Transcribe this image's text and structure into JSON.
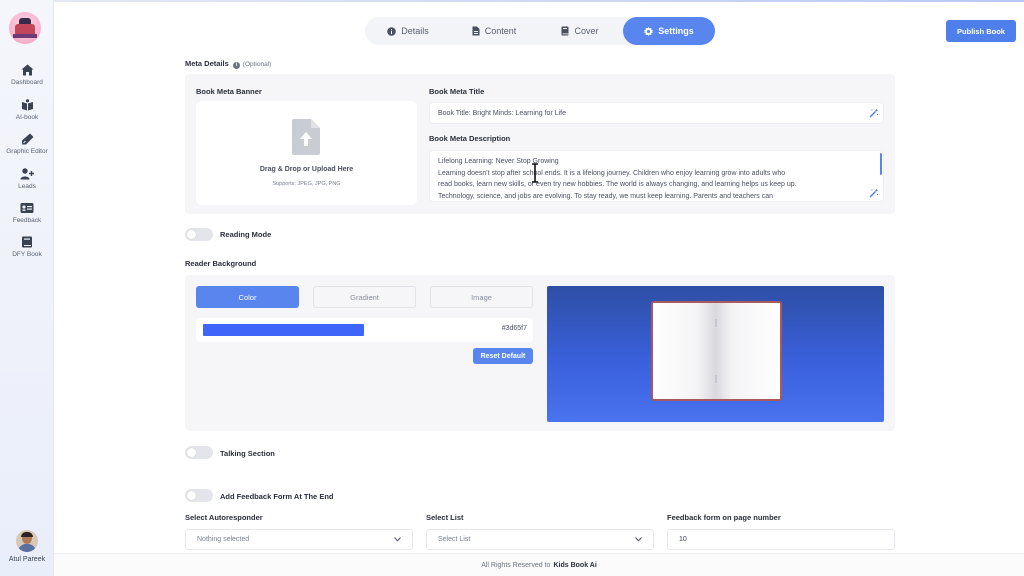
{
  "sidebar": {
    "items": [
      {
        "label": "Dashboard",
        "icon": "home-icon"
      },
      {
        "label": "AI-book",
        "icon": "ai-book-icon"
      },
      {
        "label": "Graphic Editor",
        "icon": "pen-icon"
      },
      {
        "label": "Leads",
        "icon": "add-user-icon"
      },
      {
        "label": "Feedback",
        "icon": "feedback-icon"
      },
      {
        "label": "DFY Book",
        "icon": "book-icon"
      }
    ],
    "user_name": "Atul Pareek"
  },
  "tabs": [
    {
      "label": "Details",
      "icon": "info-icon",
      "active": false
    },
    {
      "label": "Content",
      "icon": "document-icon",
      "active": false
    },
    {
      "label": "Cover",
      "icon": "book-icon",
      "active": false
    },
    {
      "label": "Settings",
      "icon": "gear-icon",
      "active": true
    }
  ],
  "publish_label": "Publish Book",
  "meta": {
    "title": "Meta Details",
    "optional": "(Optional)",
    "banner_label": "Book Meta Banner",
    "upload_title": "Drag & Drop or Upload Here",
    "upload_sub": "Supports: JPEG, JPG, PNG",
    "meta_title_label": "Book Meta Title",
    "meta_title_value": "Book Title: Bright Minds: Learning for Life",
    "meta_desc_label": "Book Meta Description",
    "meta_desc_line1": "Lifelong Learning: Never Stop Growing",
    "meta_desc_line2": "Learning doesn't stop after school ends. It is a lifelong journey. Children who enjoy learning grow into adults who",
    "meta_desc_line3": "read books, learn new skills, or even try new hobbies. The world is always changing, and learning helps us keep up.",
    "meta_desc_line4": "Technology, science, and jobs are evolving. To stay ready, we must keep learning. Parents and teachers can"
  },
  "reading_mode_label": "Reading Mode",
  "reader_bg": {
    "title": "Reader Background",
    "tabs": [
      "Color",
      "Gradient",
      "Image"
    ],
    "color_hex": "#3d65f7",
    "reset_label": "Reset Default"
  },
  "talking_section_label": "Talking Section",
  "feedback_form_label": "Add Feedback Form At The End",
  "selects": {
    "autoresponder_label": "Select Autoresponder",
    "autoresponder_value": "Nothing selected",
    "list_label": "Select List",
    "list_value": "Select List",
    "page_label": "Feedback form on page number",
    "page_value": "10"
  },
  "footer": {
    "text": "All Rights Reserved to",
    "brand": "Kids Book Ai"
  },
  "colors": {
    "accent": "#5886ee",
    "publish": "#4f7fea",
    "swatch": "#3d65f7"
  }
}
